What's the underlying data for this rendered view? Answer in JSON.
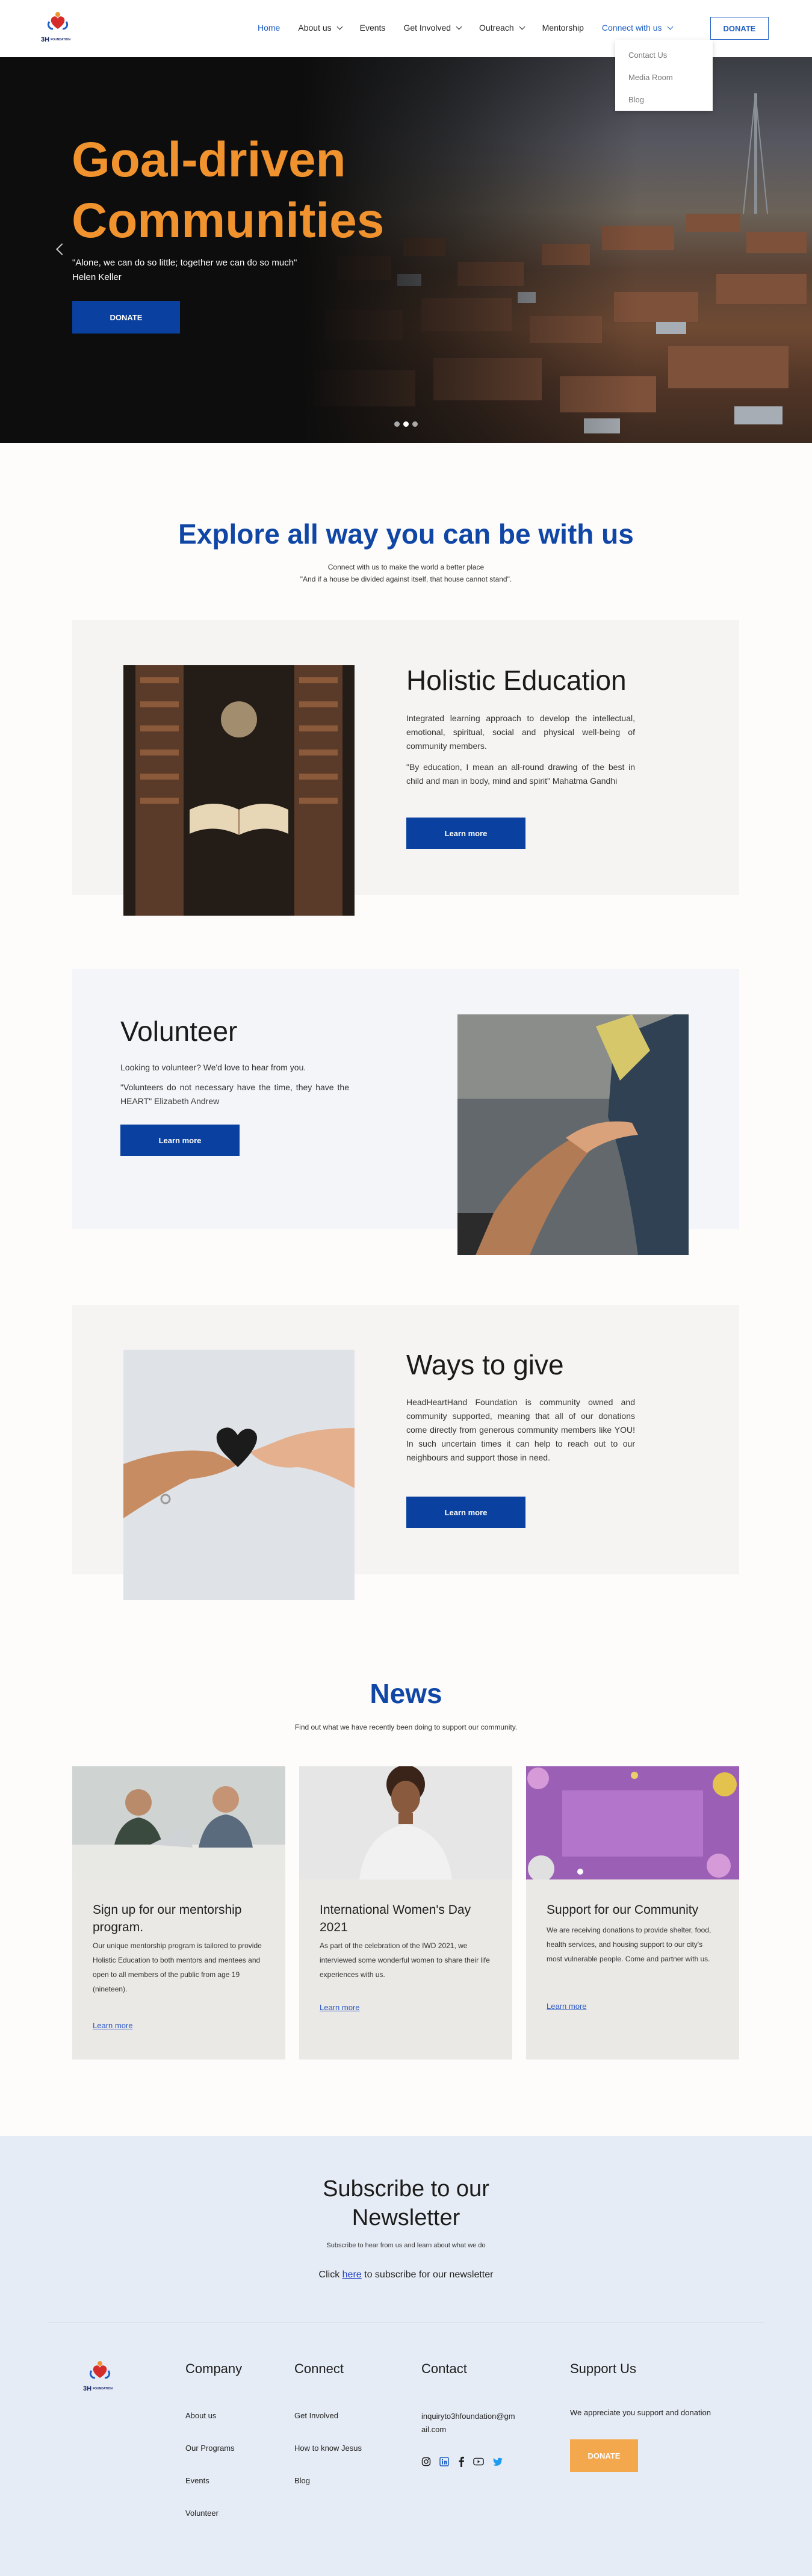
{
  "header": {
    "logo_alt": "3H Foundation",
    "logo_text": "3H",
    "logo_sub": "FOUNDATION",
    "nav": [
      {
        "label": "Home",
        "active": true,
        "dropdown": false
      },
      {
        "label": "About us",
        "active": false,
        "dropdown": true
      },
      {
        "label": "Events",
        "active": false,
        "dropdown": false
      },
      {
        "label": "Get Involved",
        "active": false,
        "dropdown": true
      },
      {
        "label": "Outreach",
        "active": false,
        "dropdown": true
      },
      {
        "label": "Mentorship",
        "active": false,
        "dropdown": false
      },
      {
        "label": "Connect with us",
        "active": true,
        "dropdown": true
      }
    ],
    "donate_label": "DONATE",
    "dropdown_items": [
      "Contact Us",
      "Media Room",
      "Blog"
    ]
  },
  "hero": {
    "title": "Goal-driven Communities",
    "quote": "\"Alone, we can do so little; together we can do so much\"",
    "author": "Helen Keller",
    "button": "DONATE",
    "slides": 3,
    "active_slide": 2
  },
  "explore": {
    "title": "Explore all way you can be with us",
    "subtitle": "Connect with us to make the world a better place",
    "quote": "\"And if a house be divided against itself, that house cannot stand\"."
  },
  "sections": [
    {
      "title": "Holistic Education",
      "text1": "Integrated learning approach to develop the intellectual, emotional, spiritual, social and physical well-being of community members.",
      "text2": "\"By education, I mean an all-round drawing of the best in child and man in body, mind and spirit\" Mahatma Gandhi",
      "button": "Learn more"
    },
    {
      "title": "Volunteer",
      "text1": "Looking to volunteer? We'd love to hear from you.",
      "text2": "\"Volunteers do not necessary have the time, they have the HEART\" Elizabeth Andrew",
      "button": "Learn more"
    },
    {
      "title": "Ways to give",
      "text1": "HeadHeartHand Foundation is community owned and community supported, meaning that all of our donations come directly from generous community members like YOU! In such uncertain times it can help to reach out to our neighbours and support those in need.",
      "button": "Learn more"
    }
  ],
  "news": {
    "title": "News",
    "subtitle": "Find out what we have recently been doing to support our community.",
    "items": [
      {
        "title": "Sign up for our mentorship program.",
        "text": "Our unique mentorship program is tailored to provide Holistic Education to both mentors and mentees and open to all members of the public from age 19 (nineteen).",
        "link": "Learn more"
      },
      {
        "title": "International Women's Day 2021",
        "text": "As part of the celebration of the IWD 2021, we interviewed some wonderful women to share their life experiences with us.",
        "link": "Learn more"
      },
      {
        "title": "Support for our Community",
        "text": "We are receiving donations to provide shelter, food, health services, and housing support to our city's most vulnerable people. Come and partner with us.",
        "link": "Learn more"
      }
    ]
  },
  "subscribe": {
    "title": "Subscribe to our Newsletter",
    "small": "Subscribe to hear from us and learn about what we do",
    "click_prefix": "Click ",
    "click_link": "here",
    "click_suffix": " to subscribe for our newsletter"
  },
  "footer": {
    "company_title": "Company",
    "company_links": [
      "About us",
      "Our Programs",
      "Events",
      "Volunteer"
    ],
    "connect_title": "Connect",
    "connect_links": [
      "Get Involved",
      "How to know Jesus",
      "Blog"
    ],
    "contact_title": "Contact",
    "contact_email": "inquiryto3hfoundation@gmail.com",
    "socials": [
      "instagram-icon",
      "linkedin-icon",
      "facebook-icon",
      "youtube-icon",
      "twitter-icon"
    ],
    "support_title": "Support Us",
    "support_text": "We appreciate you support and donation",
    "donate_label": "DONATE"
  },
  "colors": {
    "brand_blue": "#0a40a0",
    "accent_orange": "#f0922e",
    "donate_orange": "#f4a84e"
  }
}
